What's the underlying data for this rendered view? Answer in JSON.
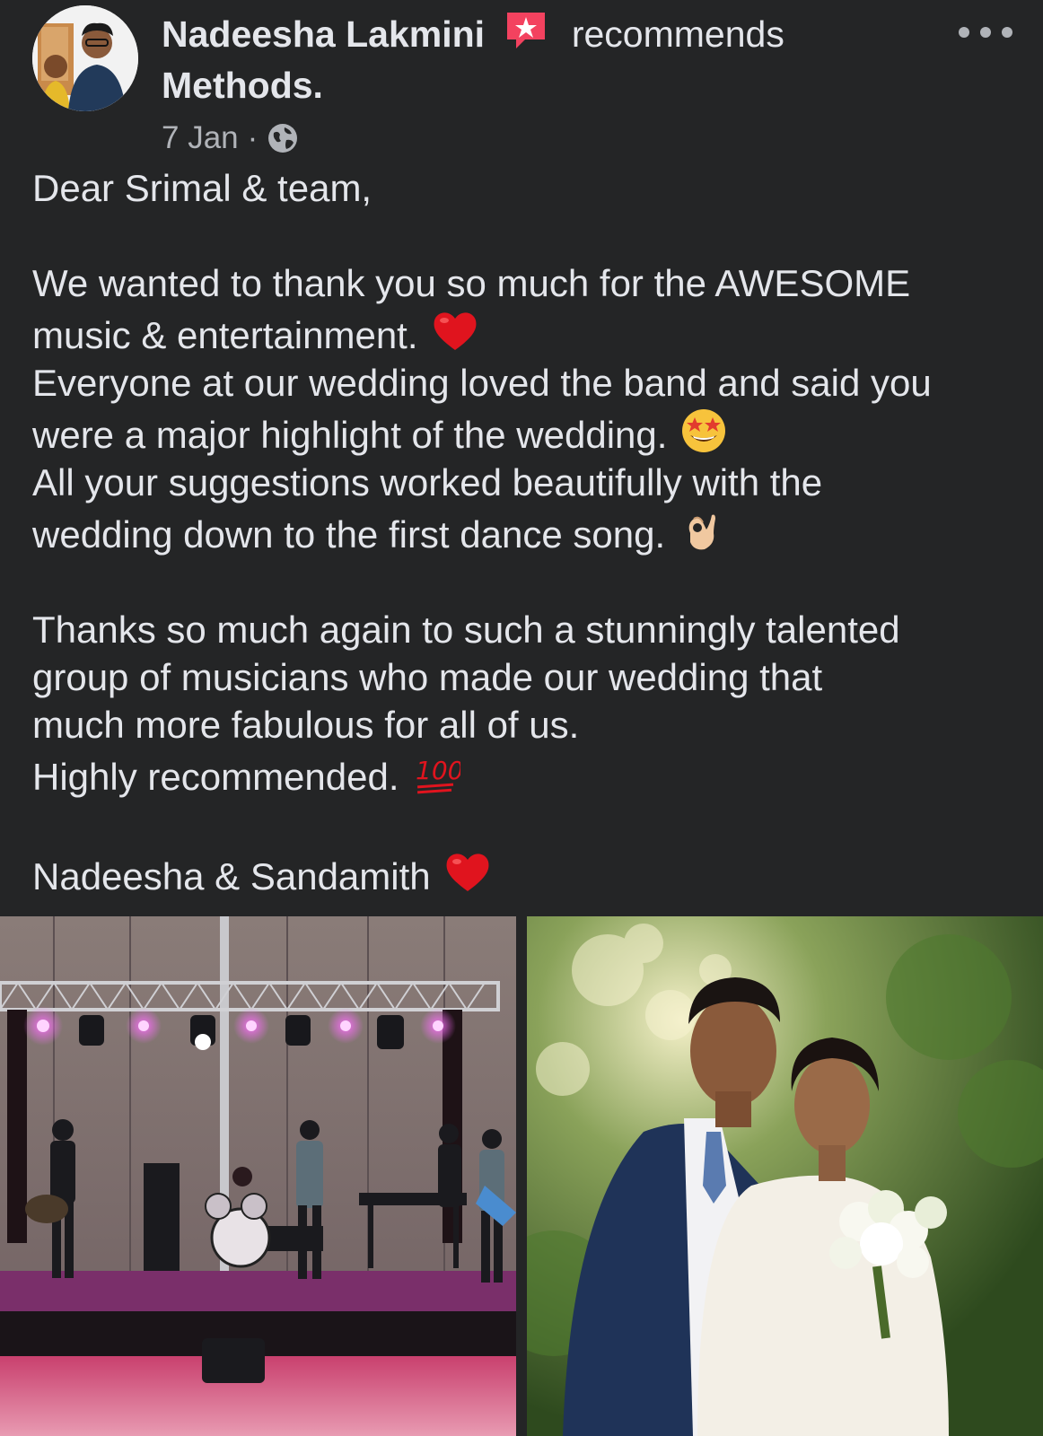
{
  "post": {
    "author": "Nadeesha Lakmini",
    "action": "recommends",
    "page": "Methods.",
    "date": "7 Jan",
    "separator": "·",
    "visibility_icon": "globe-icon",
    "recommend_icon": "recommend-star-icon",
    "more_icon": "more-horizontal-icon"
  },
  "body": {
    "greeting": "Dear Srimal & team,",
    "lines": [
      "We wanted to thank you so much for the AWESOME",
      "music & entertainment.",
      "Everyone at our wedding loved the band and said you",
      "were a major highlight of the wedding.",
      "All your suggestions worked beautifully with the",
      "wedding down to the first dance song.",
      "Thanks so much again to such a stunningly talented",
      "group of musicians who made our wedding that",
      "much more fabulous for all of us.",
      "Highly recommended.",
      "Nadeesha & Sandamith"
    ],
    "emojis": [
      "red-heart",
      "star-struck",
      "ok-hand",
      "hundred-points",
      "red-heart"
    ]
  },
  "photos": [
    {
      "description_icon": "band-stage-photo"
    },
    {
      "description_icon": "couple-photo"
    }
  ],
  "colors": {
    "background": "#242526",
    "text": "#e4e6eb",
    "secondary_text": "#b0b3b8",
    "recommend_badge": "#f3425f"
  }
}
